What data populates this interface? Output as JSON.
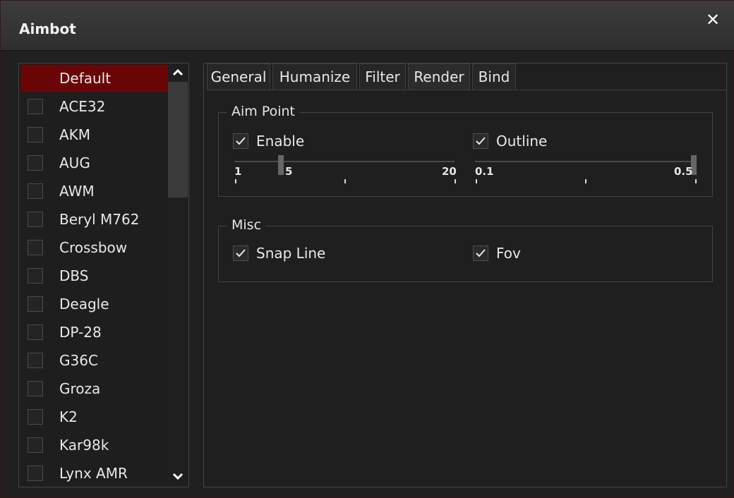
{
  "window": {
    "title": "Aimbot"
  },
  "icons": {
    "close": "close-icon",
    "scroll_up": "chevron-up-icon",
    "scroll_down": "chevron-down-icon",
    "check": "checkmark-icon"
  },
  "colors": {
    "accent": "#6a0505",
    "background": "#202020",
    "border": "#444444"
  },
  "weapons": {
    "items": [
      {
        "label": "Default",
        "selected": true,
        "checked": false
      },
      {
        "label": "ACE32",
        "checked": false
      },
      {
        "label": "AKM",
        "checked": false
      },
      {
        "label": "AUG",
        "checked": false
      },
      {
        "label": "AWM",
        "checked": false
      },
      {
        "label": "Beryl M762",
        "checked": false
      },
      {
        "label": "Crossbow",
        "checked": false
      },
      {
        "label": "DBS",
        "checked": false
      },
      {
        "label": "Deagle",
        "checked": false
      },
      {
        "label": "DP-28",
        "checked": false
      },
      {
        "label": "G36C",
        "checked": false
      },
      {
        "label": "Groza",
        "checked": false
      },
      {
        "label": "K2",
        "checked": false
      },
      {
        "label": "Kar98k",
        "checked": false
      },
      {
        "label": "Lynx AMR",
        "checked": false
      }
    ]
  },
  "tabs": [
    {
      "label": "General"
    },
    {
      "label": "Humanize"
    },
    {
      "label": "Filter"
    },
    {
      "label": "Render",
      "active": true
    },
    {
      "label": "Bind"
    }
  ],
  "aim_point": {
    "legend": "Aim Point",
    "enable": {
      "label": "Enable",
      "checked": true
    },
    "outline": {
      "label": "Outline",
      "checked": true
    },
    "size_slider": {
      "min_label": "1",
      "value_label": "5",
      "max_label": "20",
      "min": 1,
      "max": 20,
      "value": 5
    },
    "thickness_slider": {
      "min_label": "0.1",
      "max_label": "0.5",
      "min": 0.1,
      "max": 0.5,
      "value": 0.5
    }
  },
  "misc": {
    "legend": "Misc",
    "snap_line": {
      "label": "Snap Line",
      "checked": true
    },
    "fov": {
      "label": "Fov",
      "checked": true
    }
  }
}
